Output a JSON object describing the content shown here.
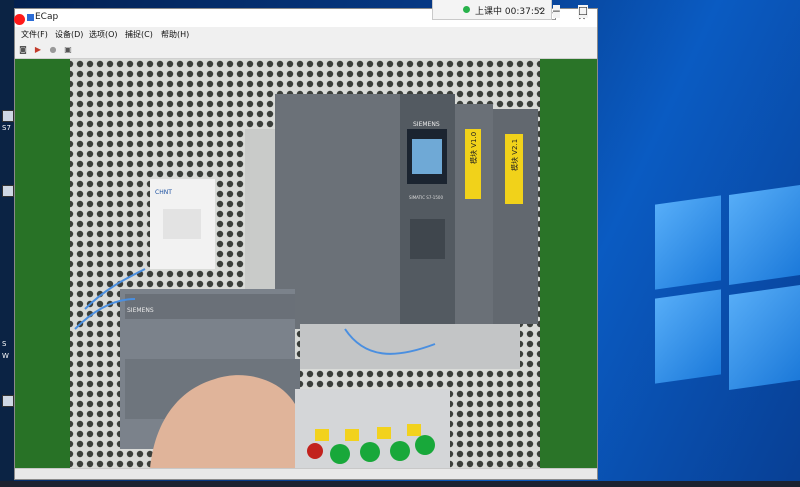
{
  "window": {
    "title": "ECap",
    "minimize": "─",
    "maximize": "☐",
    "close": "✕"
  },
  "menu": [
    {
      "label": "文件(F)"
    },
    {
      "label": "设备(D)"
    },
    {
      "label": "选项(O)"
    },
    {
      "label": "捕捉(C)"
    },
    {
      "label": "帮助(H)"
    }
  ],
  "toolbar": [
    {
      "icon": "camera-icon",
      "glyph": "◙"
    },
    {
      "icon": "play-icon",
      "glyph": "▶"
    },
    {
      "icon": "stop-icon",
      "glyph": "●"
    },
    {
      "icon": "settings-icon",
      "glyph": "▣"
    }
  ],
  "class_timer": {
    "status": "上课中",
    "time": "00:37:52",
    "chevron": "⌄"
  },
  "outer_controls": {
    "minimize": "─",
    "maximize": "☐"
  },
  "video_labels": {
    "plc_brand": "SIEMENS",
    "plc_model": "SIMATIC S7-1500",
    "module_1": "模块 V1.0",
    "module_2": "模块 V2.1",
    "compact_brand": "SIEMENS",
    "breaker_brand": "CHNT"
  },
  "desktop_icons": [
    {
      "label": "S7"
    },
    {
      "label": "S"
    },
    {
      "label": "W"
    }
  ],
  "colors": {
    "record": "#ff1a1a",
    "timer_dot": "#28b24b",
    "backdrop_green": "#2d7a2a"
  }
}
